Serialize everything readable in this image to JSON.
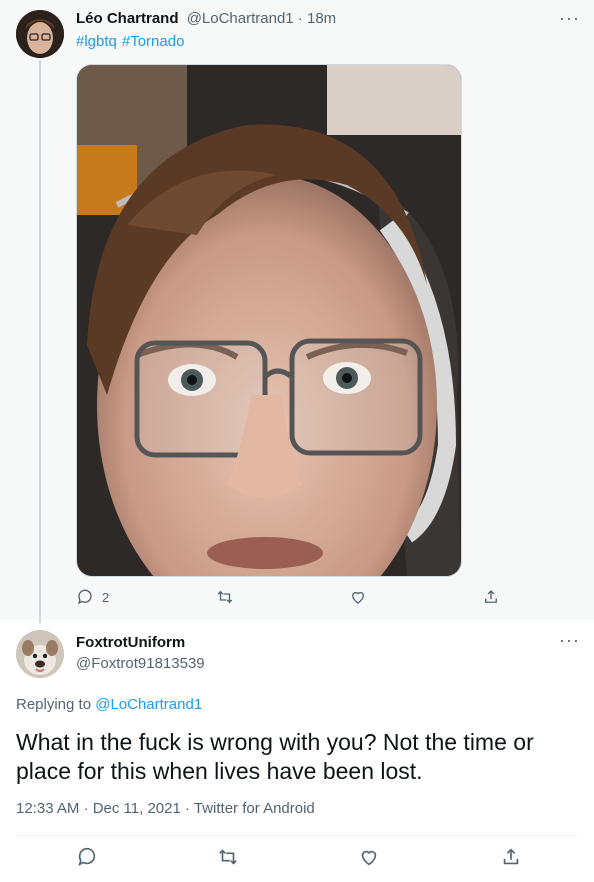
{
  "parent_tweet": {
    "display_name": "Léo Chartrand",
    "handle": "@LoChartrand1",
    "separator": "·",
    "time": "18m",
    "hashtags": [
      "#lgbtq",
      "#Tornado"
    ],
    "media_alt": "selfie-photo",
    "reply_count": "2",
    "more_label": "···"
  },
  "reply_tweet": {
    "display_name": "FoxtrotUniform",
    "handle": "@Foxtrot91813539",
    "replying_prefix": "Replying to",
    "replying_handle": "@LoChartrand1",
    "text": "What in the fuck is wrong with you? Not the time or place for this when lives have been lost.",
    "timestamp": "12:33 AM · Dec 11, 2021 · Twitter for Android",
    "more_label": "···"
  },
  "colors": {
    "accent": "#1d9bf0",
    "muted": "#536471",
    "parent_bg": "#f7f9f9"
  },
  "icons": [
    "reply-icon",
    "retweet-icon",
    "like-icon",
    "share-icon",
    "more-icon"
  ]
}
